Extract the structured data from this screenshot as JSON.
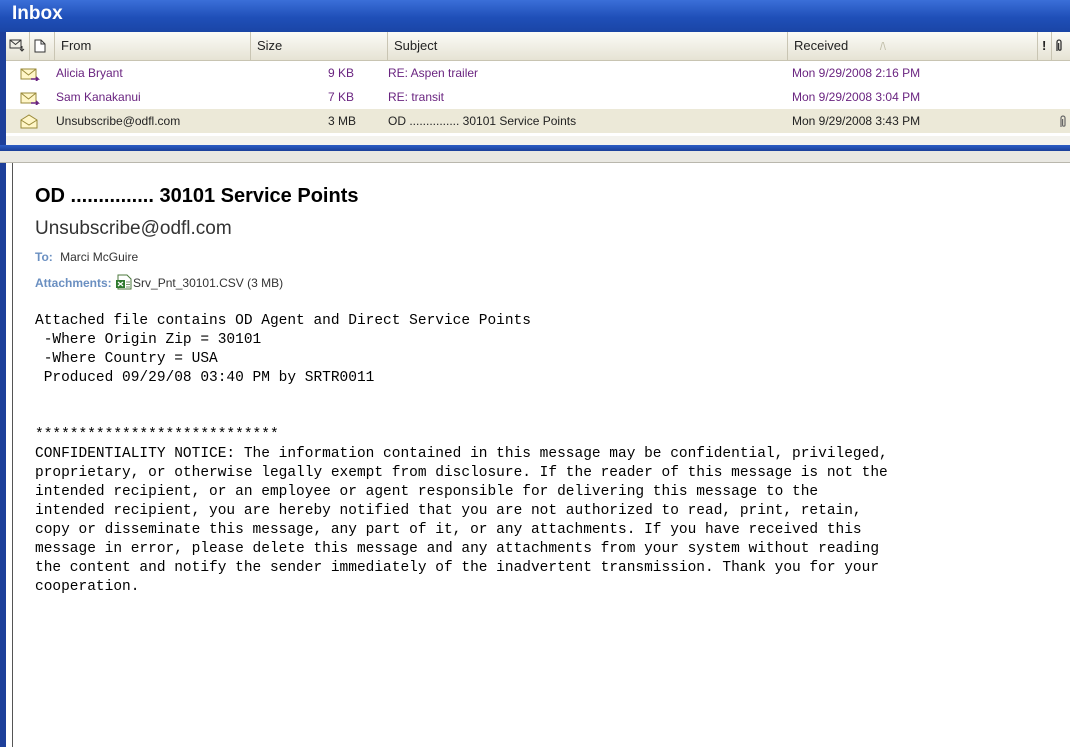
{
  "window": {
    "title": "Inbox"
  },
  "columns": {
    "importance_icon": "envelope-sort-icon",
    "attachment_icon": "page-icon",
    "from": "From",
    "size": "Size",
    "subject": "Subject",
    "received": "Received",
    "sort_indicator": "/\\",
    "flags": "!",
    "paperclip": "paperclip-icon"
  },
  "messages": [
    {
      "from": "Alicia Bryant",
      "size": "9 KB",
      "subject": "RE: Aspen trailer",
      "received": "Mon 9/29/2008 2:16 PM",
      "has_attachment": false
    },
    {
      "from": "Sam Kanakanui",
      "size": "7 KB",
      "subject": "RE: transit",
      "received": "Mon 9/29/2008 3:04 PM",
      "has_attachment": false
    },
    {
      "from": "Unsubscribe@odfl.com",
      "size": "3 MB",
      "subject": "OD ............... 30101 Service Points",
      "received": "Mon 9/29/2008 3:43 PM",
      "has_attachment": true
    }
  ],
  "preview": {
    "subject": "OD ............... 30101 Service Points",
    "sender": "Unsubscribe@odfl.com",
    "to_label": "To:",
    "to_value": "Marci McGuire",
    "attachments_label": "Attachments:",
    "attachment_name": "Srv_Pnt_30101.CSV (3 MB)",
    "body": "Attached file contains OD Agent and Direct Service Points\n -Where Origin Zip = 30101\n -Where Country = USA\n Produced 09/29/08 03:40 PM by SRTR0011\n\n\n****************************\nCONFIDENTIALITY NOTICE: The information contained in this message may be confidential, privileged,\nproprietary, or otherwise legally exempt from disclosure. If the reader of this message is not the\nintended recipient, or an employee or agent responsible for delivering this message to the\nintended recipient, you are hereby notified that you are not authorized to read, print, retain,\ncopy or disseminate this message, any part of it, or any attachments. If you have received this\nmessage in error, please delete this message and any attachments from your system without reading\nthe content and notify the sender immediately of the inadvertent transmission. Thank you for your\ncooperation."
  },
  "colors": {
    "title_bar": "#1f4fb8",
    "unread_text": "#6a2480",
    "selected_row": "#ece9d8",
    "label_blue": "#6a8fc1"
  }
}
